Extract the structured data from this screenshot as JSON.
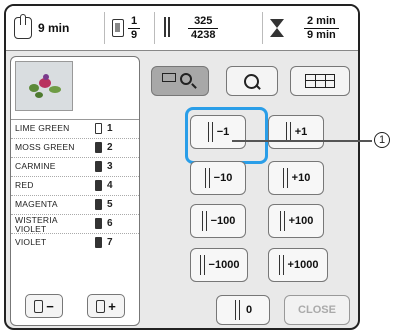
{
  "status": {
    "time_remaining": "9 min",
    "color_fraction": {
      "current": "1",
      "total": "9"
    },
    "stitch_fraction": {
      "current": "325",
      "total": "4238"
    },
    "time_fraction": {
      "current": "2 min",
      "total": "9 min"
    }
  },
  "threads": [
    {
      "name": "LIME GREEN",
      "number": "1",
      "hollow": true
    },
    {
      "name": "MOSS GREEN",
      "number": "2"
    },
    {
      "name": "CARMINE",
      "number": "3"
    },
    {
      "name": "RED",
      "number": "4"
    },
    {
      "name": "MAGENTA",
      "number": "5"
    },
    {
      "name": "WISTERIA VIOLET",
      "number": "6"
    },
    {
      "name": "VIOLET",
      "number": "7"
    }
  ],
  "spool_buttons": {
    "minus": "−",
    "plus": "+"
  },
  "step_buttons": {
    "minus_1": "−1",
    "plus_1": "+1",
    "minus_10": "−10",
    "plus_10": "+10",
    "minus_100": "−100",
    "plus_100": "+100",
    "minus_1000": "−1000",
    "plus_1000": "+1000"
  },
  "bottom": {
    "zero": "0",
    "close": "CLOSE"
  },
  "callout_number": "1",
  "colors": {
    "highlight": "#2a9ee8"
  }
}
